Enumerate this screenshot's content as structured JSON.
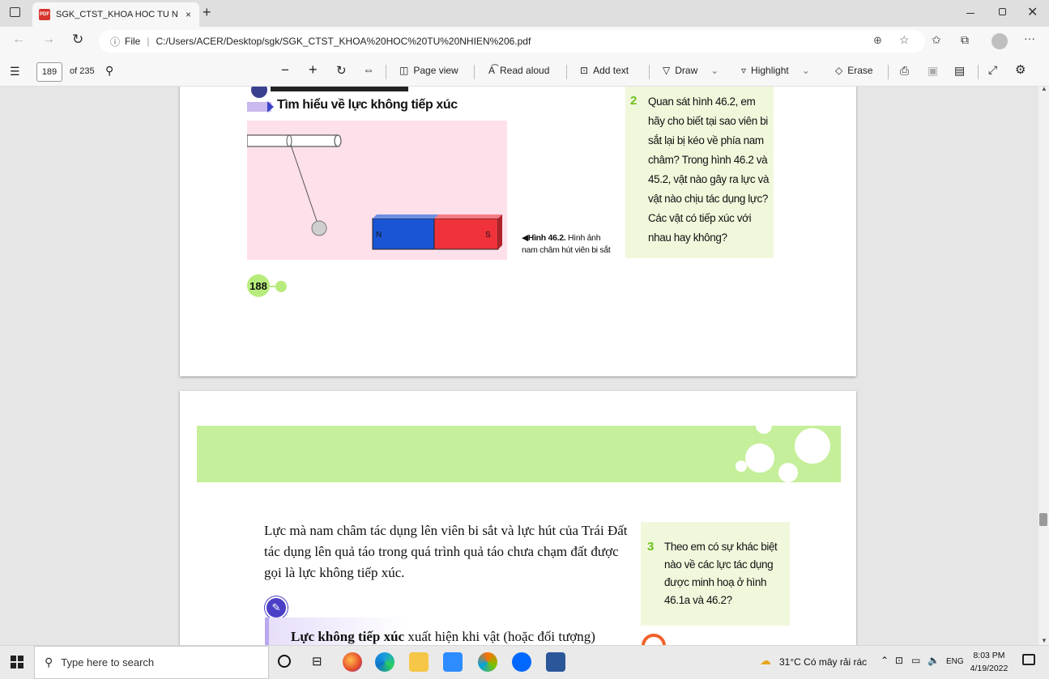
{
  "browser": {
    "tab_title": "SGK_CTST_KHOA HOC TU NHIEN",
    "tab_close": "×",
    "new_tab": "+",
    "url_prefix": "File",
    "url": "C:/Users/ACER/Desktop/sgk/SGK_CTST_KHOA%20HOC%20TU%20NHIEN%206.pdf"
  },
  "pdf_toolbar": {
    "page_number": "189",
    "page_total": "of 235",
    "page_view": "Page view",
    "read_aloud": "Read aloud",
    "add_text": "Add text",
    "draw": "Draw",
    "highlight": "Highlight",
    "erase": "Erase"
  },
  "page1": {
    "section_heading": "Tìm hiểu về lực không tiếp xúc",
    "magnet_n": "N",
    "magnet_s": "S",
    "caption_prefix": "Hình 46.2.",
    "caption_text": "Hình ảnh nam châm hút viên bi sắt",
    "question_number": "2",
    "question_text": "Quan sát hình 46.2, em hãy cho biết tại sao viên bi sắt lại bị kéo về phía nam châm? Trong hình 46.2 và 45.2, vật nào gây ra lực và vật nào chịu tác dụng lực? Các vật có tiếp xúc với nhau hay không?",
    "page_label": "188"
  },
  "page2": {
    "paragraph": "Lực mà nam châm tác dụng lên viên bi sắt và lực hút của Trái Đất tác dụng lên quả táo trong quá trình quả táo chưa chạm đất được gọi là lực không tiếp xúc.",
    "question_number": "3",
    "question_text": "Theo em có sự khác biệt nào về các lực tác dụng được minh hoạ ở hình 46.1a và 46.2?",
    "note_bold": "Lực không tiếp xúc",
    "note_text": " xuất hiện khi vật (hoặc đối tượng)"
  },
  "taskbar": {
    "search_placeholder": "Type here to search",
    "weather": "31°C  Có mây rải rác",
    "lang": "ENG",
    "time": "8:03 PM",
    "date": "4/19/2022"
  },
  "colors": {
    "green_box": "#f0f8dc",
    "green_band": "#c5ef9a",
    "pink_figure": "#fde0ea",
    "magnet_blue": "#1a55d6",
    "magnet_red": "#f0323a"
  }
}
